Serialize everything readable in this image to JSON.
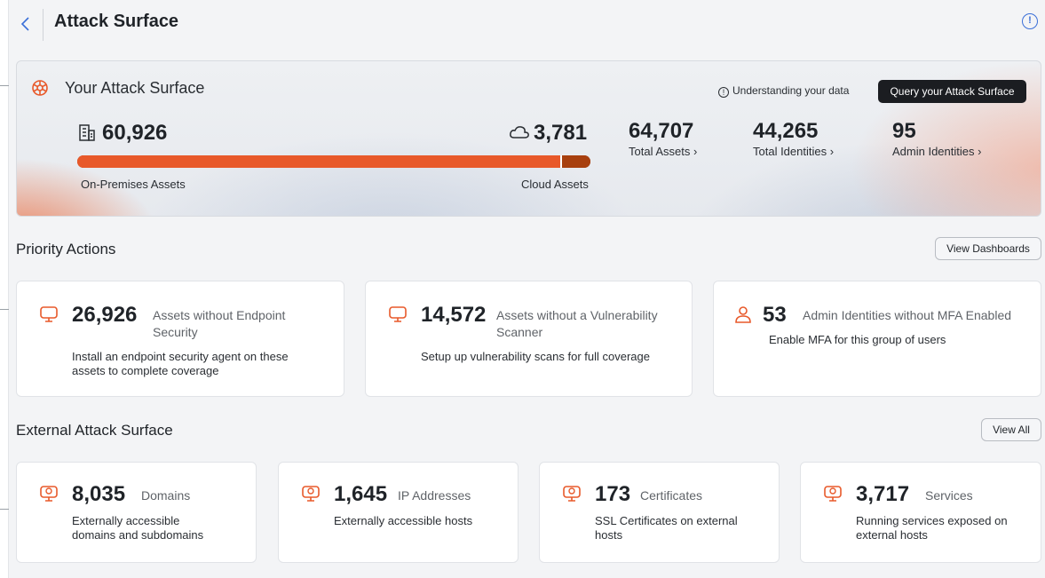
{
  "header": {
    "title": "Attack Surface",
    "back_icon": "chevron-left-icon",
    "info_icon": "info-icon"
  },
  "colors": {
    "accent": "#e8592a",
    "accent_dark": "#a8400f",
    "link_blue": "#3a6fd8",
    "dark_button": "#1b1d21"
  },
  "hero": {
    "title": "Your Attack Surface",
    "understanding_link": "Understanding your data",
    "query_button": "Query your Attack Surface",
    "on_premises": {
      "value": "60,926",
      "label": "On-Premises Assets",
      "share": 0.942
    },
    "cloud": {
      "value": "3,781",
      "label": "Cloud Assets",
      "share": 0.058
    },
    "stats": [
      {
        "value": "64,707",
        "label": "Total Assets ›"
      },
      {
        "value": "44,265",
        "label": "Total Identities ›"
      },
      {
        "value": "95",
        "label": "Admin Identities ›"
      }
    ]
  },
  "priority": {
    "title": "Priority Actions",
    "button": "View Dashboards",
    "cards": [
      {
        "value": "26,926",
        "title_line1": "Assets without Endpoint",
        "title_line2": "Security",
        "desc_line1": "Install an endpoint security agent on these",
        "desc_line2": "assets to complete coverage",
        "icon": "monitor-icon"
      },
      {
        "value": "14,572",
        "title_line1": "Assets without a Vulnerability",
        "title_line2": "Scanner",
        "desc_line1": "Setup up vulnerability scans for full coverage",
        "desc_line2": "",
        "icon": "monitor-icon"
      },
      {
        "value": "53",
        "title_line1": "Admin Identities without MFA Enabled",
        "title_line2": "",
        "desc_line1": "Enable MFA for this group of users",
        "desc_line2": "",
        "icon": "user-icon"
      }
    ]
  },
  "external": {
    "title": "External Attack Surface",
    "button": "View All",
    "cards": [
      {
        "value": "8,035",
        "label": "Domains",
        "desc_line1": "Externally accessible",
        "desc_line2": "domains and subdomains",
        "icon": "globe-monitor-icon"
      },
      {
        "value": "1,645",
        "label": "IP Addresses",
        "desc_line1": "Externally accessible hosts",
        "desc_line2": "",
        "icon": "globe-monitor-icon"
      },
      {
        "value": "173",
        "label": "Certificates",
        "desc_line1": "SSL Certificates on external",
        "desc_line2": "hosts",
        "icon": "globe-monitor-icon"
      },
      {
        "value": "3,717",
        "label": "Services",
        "desc_line1": "Running services exposed on",
        "desc_line2": "external hosts",
        "icon": "globe-monitor-icon"
      }
    ]
  }
}
